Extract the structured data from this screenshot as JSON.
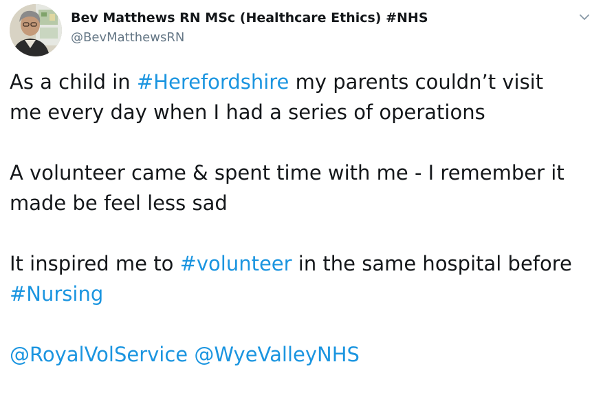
{
  "author": {
    "display_name": "Bev Matthews RN MSc (Healthcare Ethics) #NHS",
    "handle": "@BevMatthewsRN",
    "avatar_icon": "profile-photo"
  },
  "menu": {
    "icon": "chevron-down-icon"
  },
  "tweet": {
    "p1": {
      "l1_a": "As a child in ",
      "l1_hashtag": "#Herefordshire",
      "l1_b": " my parents couldn’t visit",
      "l2": "me every day when I had a series of operations"
    },
    "p2": {
      "l1": "A volunteer came & spent time with me - I remember it",
      "l2": "made be feel less sad"
    },
    "p3": {
      "l1_a": "It inspired me to ",
      "l1_hashtag": "#volunteer",
      "l1_b": " in the same hospital before",
      "l2_hashtag": "#Nursing"
    },
    "p4": {
      "mention1": "@RoyalVolService",
      "sep": " ",
      "mention2": "@WyeValleyNHS"
    }
  },
  "colors": {
    "text": "#14171a",
    "secondary": "#657786",
    "link": "#1b95e0"
  }
}
